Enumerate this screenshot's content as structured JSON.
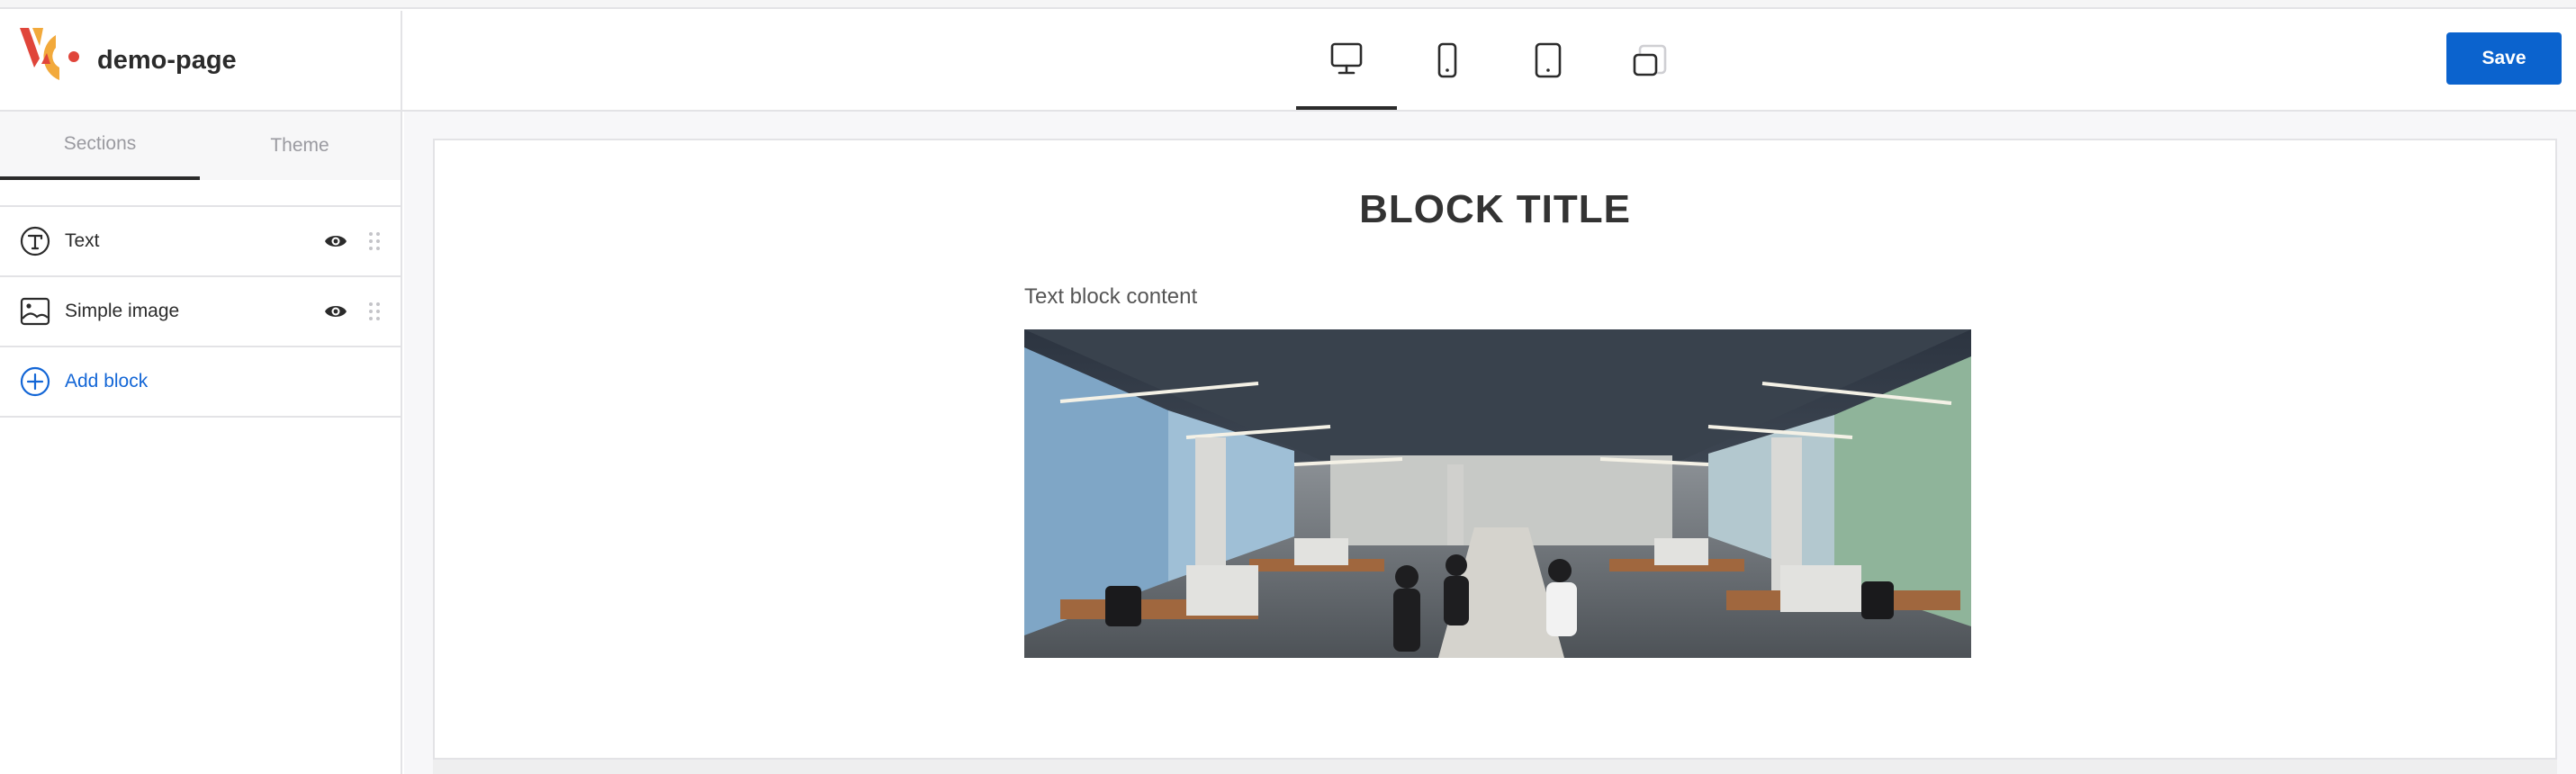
{
  "app": {
    "page_name": "demo-page"
  },
  "sidebar": {
    "tabs": [
      {
        "label": "Sections",
        "active": true
      },
      {
        "label": "Theme",
        "active": false
      }
    ],
    "blocks": [
      {
        "label": "Text",
        "icon": "text-block-icon"
      },
      {
        "label": "Simple image",
        "icon": "image-block-icon"
      }
    ],
    "add_block_label": "Add block"
  },
  "toolbar": {
    "devices": [
      {
        "name": "desktop",
        "icon": "desktop-icon",
        "active": true
      },
      {
        "name": "mobile",
        "icon": "mobile-icon",
        "active": false
      },
      {
        "name": "tablet",
        "icon": "tablet-icon",
        "active": false
      },
      {
        "name": "landscape",
        "icon": "rotate-landscape-icon",
        "active": false
      }
    ],
    "save_label": "Save"
  },
  "preview": {
    "title": "BLOCK TITLE",
    "text": "Text block content",
    "image_subject": "open-plan office with people working at desks"
  },
  "colors": {
    "accent": "#0b63ce",
    "link": "#1366d6",
    "border": "#e3e3e6",
    "text": "#2b2b2b"
  }
}
